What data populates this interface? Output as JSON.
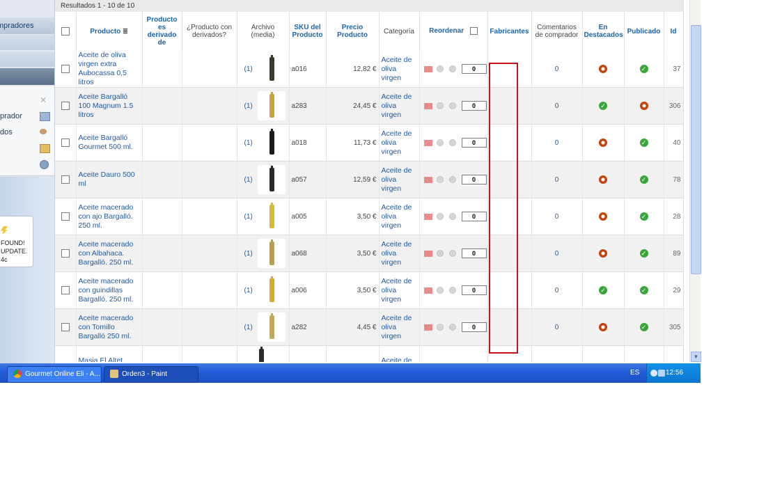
{
  "sidebar": {
    "menu_top": "mpradores",
    "items": [
      {
        "label": "prador",
        "icon": "buyer-icon"
      },
      {
        "label": "dos",
        "icon": "paint-icon"
      },
      {
        "label": "",
        "icon": "boxes-icon"
      },
      {
        "label": "",
        "icon": "globe-icon"
      }
    ],
    "notice": {
      "line1": "FOUND!",
      "line2": "UPDATE.",
      "line3": "4c"
    }
  },
  "results": "Resultados 1 - 10 de 10",
  "columns": [
    "",
    "Producto",
    "Producto es derivado de",
    "¿Producto con derivados?",
    "Archivo (media)",
    "SKU del Producto",
    "Precio Producto",
    "Categoría",
    "Reordenar",
    "Fabricantes",
    "Comentarios de comprador",
    "En Destacados",
    "Publicado",
    "Id"
  ],
  "rows": [
    {
      "name": "Aceite de oliva virgen extra Aubocassa 0,5 litros",
      "media": "(1)",
      "sku": "a016",
      "price": "12,82 €",
      "category": "Aceite de oliva virgen",
      "order": "0",
      "comments": "0",
      "featured": "red",
      "published": "green",
      "id": "37",
      "bottle": "#3c3a2a"
    },
    {
      "name": "Aceite Bargalló 100 Magnum 1.5 litros",
      "media": "(1)",
      "sku": "a283",
      "price": "24,45 €",
      "category": "Aceite de oliva virgen",
      "order": "0",
      "comments": "0",
      "featured": "green",
      "published": "red",
      "id": "306",
      "bottle": "#c9a43a"
    },
    {
      "name": "Aceite Bargalló Gourmet 500 ml.",
      "media": "(1)",
      "sku": "a018",
      "price": "11,73 €",
      "category": "Aceite de oliva virgen",
      "order": "0",
      "comments": "0",
      "featured": "red",
      "published": "green",
      "id": "40",
      "bottle": "#1b1b1b"
    },
    {
      "name": "Aceite Dauro 500 ml",
      "media": "(1)",
      "sku": "a057",
      "price": "12,59 €",
      "category": "Aceite de oliva virgen",
      "order": "0",
      "comments": "0",
      "featured": "red",
      "published": "green",
      "id": "78",
      "bottle": "#2a2a2a"
    },
    {
      "name": "Aceite macerado con ajo Bargalló. 250 ml.",
      "media": "(1)",
      "sku": "a005",
      "price": "3,50 €",
      "category": "Aceite de oliva virgen",
      "order": "0",
      "comments": "0",
      "featured": "red",
      "published": "green",
      "id": "28",
      "bottle": "#d9b93a"
    },
    {
      "name": "Aceite macerado con Albahaca. Bargalló. 250 ml.",
      "media": "(1)",
      "sku": "a068",
      "price": "3,50 €",
      "category": "Aceite de oliva virgen",
      "order": "0",
      "comments": "0",
      "featured": "red",
      "published": "green",
      "id": "89",
      "bottle": "#b8a04a"
    },
    {
      "name": "Aceite macerado con guindillas Bargalló. 250 ml.",
      "media": "(1)",
      "sku": "a006",
      "price": "3,50 €",
      "category": "Aceite de oliva virgen",
      "order": "0",
      "comments": "0",
      "featured": "green",
      "published": "green",
      "id": "29",
      "bottle": "#d8a832"
    },
    {
      "name": "Aceite macerado con Tomillo Bargalló 250 ml.",
      "media": "(1)",
      "sku": "a282",
      "price": "4,45 €",
      "category": "Aceite de oliva virgen",
      "order": "0",
      "comments": "0",
      "featured": "red",
      "published": "green",
      "id": "305",
      "bottle": "#c4ab4a"
    },
    {
      "name": "Masia El Altet",
      "media": "",
      "sku": "",
      "price": "",
      "category": "Aceite de",
      "order": "",
      "comments": "",
      "featured": "",
      "published": "",
      "id": "",
      "bottle": "#2a2a2a"
    }
  ],
  "taskbar": {
    "tasks": [
      {
        "label": "Gourmet Online Eli - A...",
        "icon": "chrome-icon"
      },
      {
        "label": "Orden3 - Paint",
        "icon": "paint-icon"
      }
    ],
    "lang": "ES",
    "clock": "12:56"
  },
  "colors": {
    "link": "#1f5aa0",
    "highlight_box": "#c0141a",
    "status_red": "#c1440e",
    "status_green": "#3aa53a",
    "taskbar": "#245edb"
  }
}
